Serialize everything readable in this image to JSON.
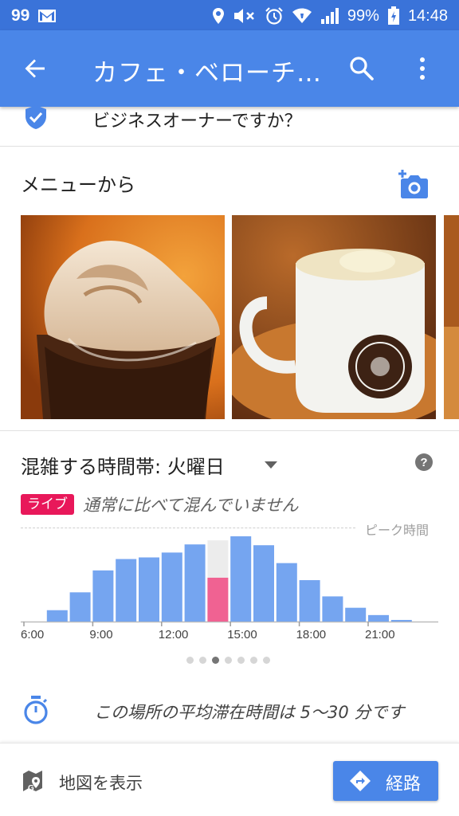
{
  "status_bar": {
    "notif_count": "99",
    "battery": "99%",
    "time": "14:48",
    "icons": [
      "gmail-icon",
      "location-icon",
      "mute-icon",
      "alarm-icon",
      "wifi-icon",
      "signal-icon",
      "battery-icon"
    ]
  },
  "app_bar": {
    "title": "カフェ・ベローチ…",
    "icons": [
      "back-arrow-icon",
      "search-icon",
      "more-vert-icon"
    ],
    "color": "#4a86e8"
  },
  "owner_prompt": "ビジネスオーナーですか？",
  "menu_section": {
    "title": "メニューから",
    "photos": [
      "soft-serve-float-photo",
      "latte-cup-photo",
      "partial-photo"
    ]
  },
  "popular_times": {
    "title": "混雑する時間帯: 火曜日",
    "live_badge": "ライブ",
    "live_text": "通常に比べて混んでいません",
    "peak_label": "ピーク時間",
    "x_labels": [
      "6:00",
      "9:00",
      "12:00",
      "15:00",
      "18:00",
      "21:00"
    ],
    "hours": [
      6,
      7,
      8,
      9,
      10,
      11,
      12,
      13,
      14,
      15,
      16,
      17,
      18,
      19,
      20,
      21,
      22,
      23
    ],
    "usual_values": [
      0,
      14,
      36,
      63,
      77,
      79,
      85,
      95,
      100,
      105,
      94,
      72,
      51,
      31,
      17,
      8,
      2,
      0
    ],
    "current_hour": 14,
    "live_value": 54,
    "bar_color": "#75a5f0",
    "live_color": "#f06292",
    "dots": 7,
    "active_dot": 3
  },
  "stay": {
    "text": "この場所の平均滞在時間は 5～30 分です"
  },
  "bottom_bar": {
    "map_label": "地図を表示",
    "route_label": "経路"
  }
}
